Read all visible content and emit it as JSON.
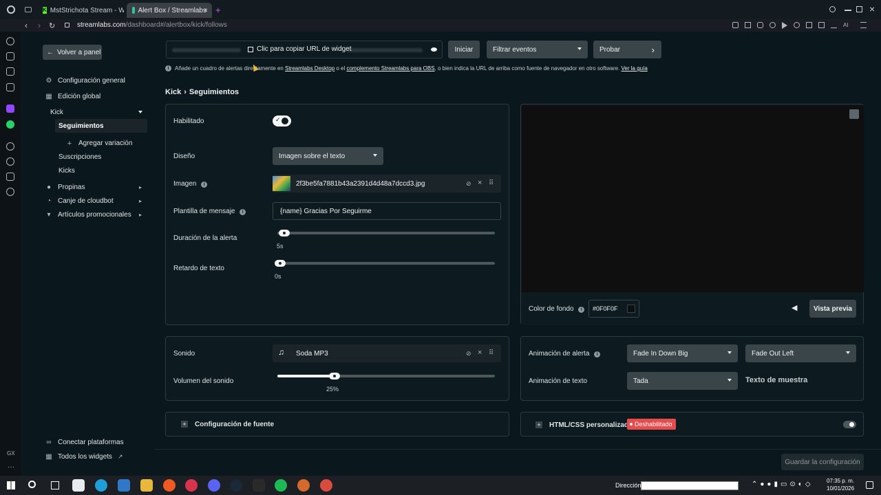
{
  "browser": {
    "tabs": [
      {
        "label": "MstStrichota Stream - Wa"
      },
      {
        "label": "Alert Box / Streamlabs"
      }
    ],
    "new_tab": "+",
    "url_host": "streamlabs.com",
    "url_path": "/dashboard#/alertbox/kick/follows"
  },
  "sidebar": {
    "back_label": "Volver a panel",
    "items": [
      {
        "label": "Configuración general",
        "icon": "gear-icon"
      },
      {
        "label": "Edición global",
        "icon": "grid-icon"
      }
    ],
    "group": "Kick",
    "active": "Seguimientos",
    "add_variation": "Agregar variación",
    "subitems": [
      "Suscripciones",
      "Kicks"
    ],
    "expandables": [
      {
        "label": "Propinas",
        "icon": "tip-icon"
      },
      {
        "label": "Canje de cloudbot",
        "icon": "cloud-icon"
      },
      {
        "label": "Artículos promocionales",
        "icon": "shirt-icon"
      }
    ],
    "connect": "Conectar plataformas",
    "all_widgets": "Todos los widgets"
  },
  "toolbar": {
    "copy_url": "Clic para copiar URL de widget",
    "start": "Iniciar",
    "filter": "Filtrar eventos",
    "test": "Probar"
  },
  "infoline": {
    "p1": "Añade un cuadro de alertas directamente en ",
    "link1": "Streamlabs Desktop",
    "p2": " o el ",
    "link2": "complemento Streamlabs para OBS",
    "p3": ", o bien indica la URL de arriba como fuente de navegador en otro software. ",
    "link3": "Ver la guía"
  },
  "breadcrumb": {
    "parent": "Kick",
    "sep": "›",
    "current": "Seguimientos"
  },
  "settings": {
    "enabled_label": "Habilitado",
    "enabled": true,
    "layout_label": "Diseño",
    "layout_value": "Imagen sobre el texto",
    "image_label": "Imagen",
    "image_file": "2f3be5fa7881b43a2391d4d48a7dccd3.jpg",
    "template_label": "Plantilla de mensaje",
    "template_value": "{name} Gracias Por Seguirme",
    "duration_label": "Duración de la alerta",
    "duration_value": "5s",
    "duration_level": 0.02,
    "delay_label": "Retardo de texto",
    "delay_value": "0s",
    "delay_level": 0.0
  },
  "preview": {
    "bg_label": "Color de fondo",
    "bg_value": "#0F0F0F",
    "bg_color": "#0f0f0f",
    "preview_button": "Vista previa"
  },
  "sound": {
    "label": "Sonido",
    "file": "Soda MP3",
    "volume_label": "Volumen del sonido",
    "volume_value": "25%",
    "volume_level": 0.25
  },
  "animation": {
    "alert_label": "Animación de alerta",
    "in_value": "Fade In Down Big",
    "out_value": "Fade Out Left",
    "text_label": "Animación de texto",
    "text_value": "Tada",
    "sample": "Texto de muestra"
  },
  "font": {
    "label": "Configuración de fuente"
  },
  "custom": {
    "label": "HTML/CSS personalizado",
    "badge": "Deshabilitado",
    "enabled": false
  },
  "save": "Guardar la configuración",
  "taskbar": {
    "address_label": "Dirección",
    "time": "07:35 p. m.",
    "date": "10/01/2026"
  },
  "colors": {
    "accent": "#31c3a2",
    "badge": "#e74c4c",
    "link": "#c45cff"
  }
}
